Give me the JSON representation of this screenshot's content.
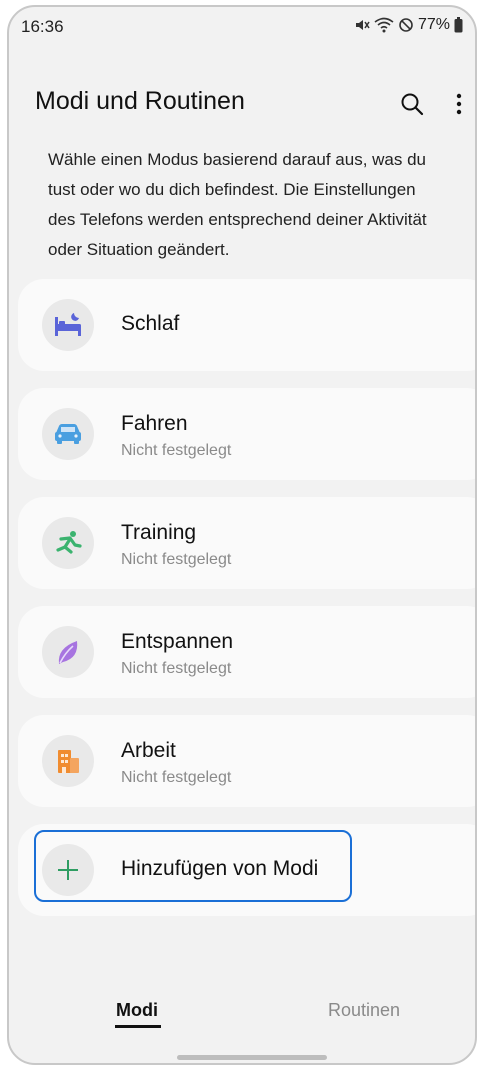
{
  "status_bar": {
    "time": "16:36",
    "battery": "77%",
    "icons": [
      "mute-icon",
      "wifi-icon",
      "no-disturb-icon",
      "battery-icon"
    ]
  },
  "header": {
    "title": "Modi und Routinen",
    "icons": [
      "search-icon",
      "more-vert-icon"
    ]
  },
  "description": {
    "lines": [
      "Wähle einen Modus basierend darauf aus, was du",
      "tust oder wo du dich befindest. Die Einstellungen",
      "des Telefons werden entsprechend deiner Aktivität",
      "oder Situation geändert."
    ]
  },
  "modes": [
    {
      "label": "Schlaf",
      "subtitle": "",
      "icon": "bed-icon",
      "color": "#5a64d8"
    },
    {
      "label": "Fahren",
      "subtitle": "Nicht festgelegt",
      "icon": "car-icon",
      "color": "#4a9fe0"
    },
    {
      "label": "Training",
      "subtitle": "Nicht festgelegt",
      "icon": "running-icon",
      "color": "#3bb36f"
    },
    {
      "label": "Entspannen",
      "subtitle": "Nicht festgelegt",
      "icon": "leaf-icon",
      "color": "#a774e0"
    },
    {
      "label": "Arbeit",
      "subtitle": "Nicht festgelegt",
      "icon": "building-icon",
      "color": "#f08c30"
    }
  ],
  "add_mode": {
    "label": "Hinzufügen von Modi",
    "icon": "plus-icon",
    "color": "#2e9d62",
    "highlight_color": "#1a6fd6"
  },
  "tabs": [
    {
      "label": "Modi",
      "active": true
    },
    {
      "label": "Routinen",
      "active": false
    }
  ]
}
